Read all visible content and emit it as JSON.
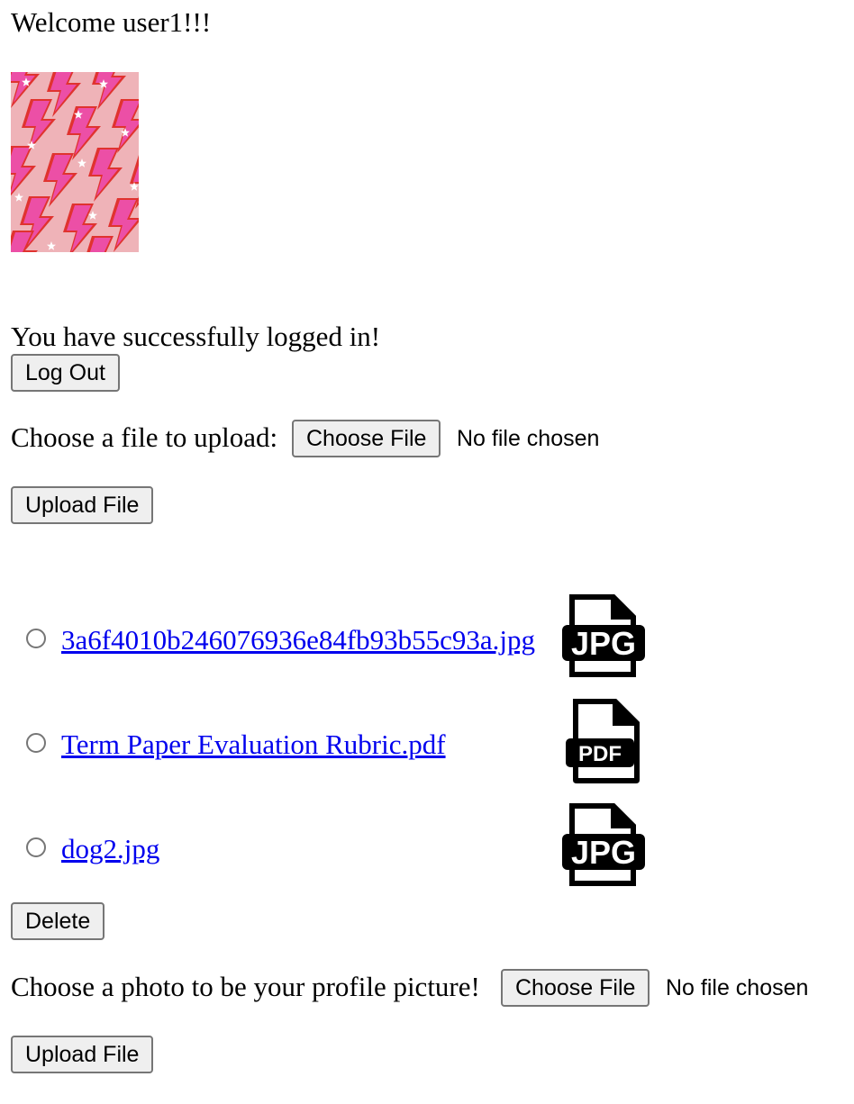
{
  "welcome_text": "Welcome user1!!!",
  "profile_image": {
    "description_icon": "profile-picture"
  },
  "login_message": "You have successfully logged in!",
  "logout_label": "Log Out",
  "upload_section": {
    "prompt": "Choose a file to upload:",
    "choose_label": "Choose File",
    "status": "No file chosen",
    "upload_label": "Upload File"
  },
  "files": [
    {
      "name": "3a6f4010b246076936e84fb93b55c93a.jpg",
      "icon": "jpg-file-icon",
      "icon_text": "JPG"
    },
    {
      "name": "Term Paper Evaluation Rubric.pdf",
      "icon": "pdf-file-icon",
      "icon_text": "PDF"
    },
    {
      "name": "dog2.jpg",
      "icon": "jpg-file-icon",
      "icon_text": "JPG"
    }
  ],
  "delete_label": "Delete",
  "profile_section": {
    "prompt": "Choose a photo to be your profile picture!",
    "choose_label": "Choose File",
    "status": "No file chosen",
    "upload_label": "Upload File"
  },
  "colors": {
    "link": "#0000ee",
    "button_bg": "#efefef",
    "button_border": "#767676",
    "pattern_bg": "#efb3b8",
    "bolt_pink": "#ec4fa6",
    "bolt_red": "#e0332f"
  }
}
